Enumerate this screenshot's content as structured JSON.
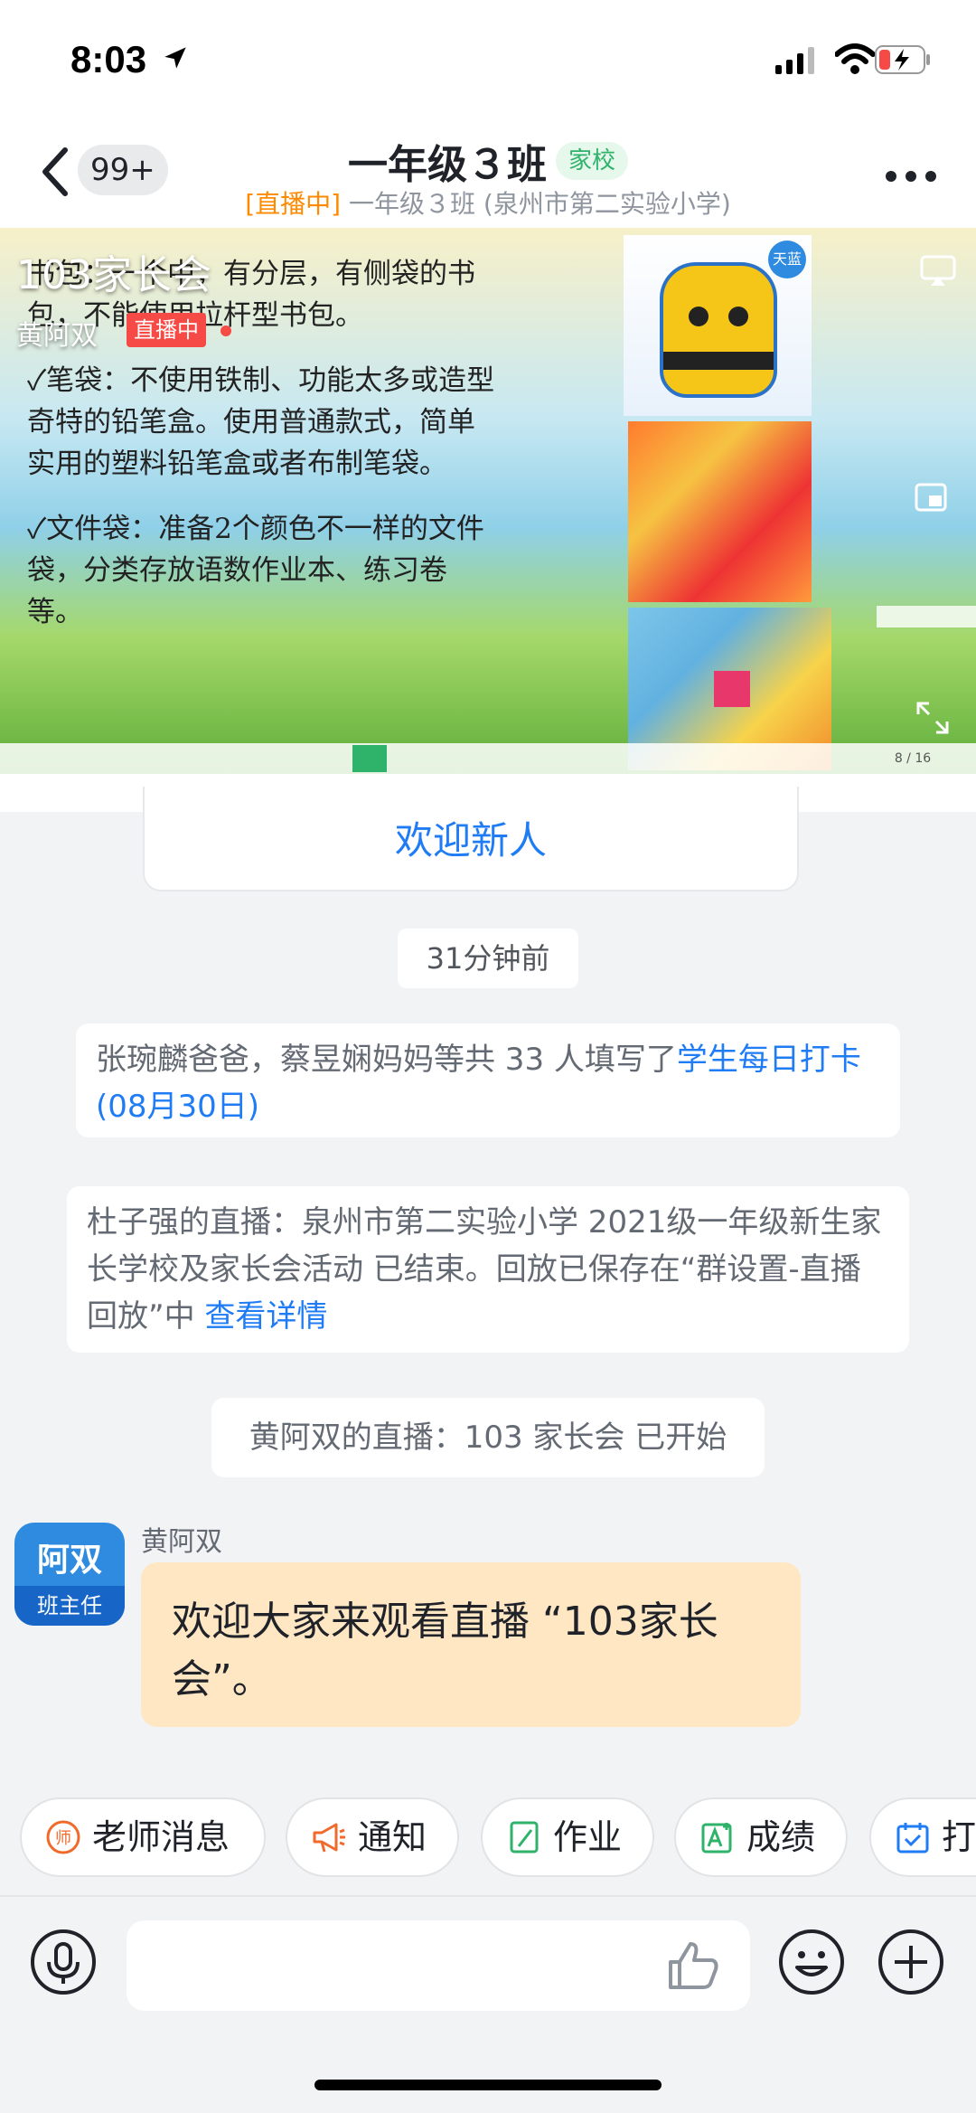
{
  "status": {
    "time": "8:03",
    "icons": [
      "location-arrow-icon",
      "signal-icon",
      "wifi-icon",
      "battery-charging-icon"
    ]
  },
  "header": {
    "back_badge": "99+",
    "title": "一年级３班",
    "tag": "家校",
    "subtitle_live": "[直播中]",
    "subtitle": " 一年级３班 (泉州市第二实验小学)"
  },
  "video": {
    "overlay_title": "103家长会",
    "host": "黄阿双",
    "live_label": "直播中",
    "slide_lines": [
      "书包：一个中，有分层，有侧袋的书包，不能使用拉杆型书包。",
      "✓笔袋：不使用铁制、功能太多或造型奇特的铅笔盒。使用普通款式，简单实用的塑料铅笔盒或者布制笔袋。",
      "✓文件袋：准备2个颜色不一样的文件袋，分类存放语数作业本、练习卷等。"
    ],
    "img_badge": "天蓝",
    "page_indicator": "8 / 16"
  },
  "chat": {
    "welcome": "欢迎新人",
    "time_chip": "31分钟前",
    "sys1_text": "张琬麟爸爸，蔡昱娴妈妈等共 33 人填写了",
    "sys1_link": "学生每日打卡 (08月30日)",
    "sys2_text": "杜子强的直播：泉州市第二实验小学 2021级一年级新生家长学校及家长会活动 已结束。回放已保存在“群设置-直播回放”中 ",
    "sys2_link": "查看详情",
    "sys3_text": "黄阿双的直播：103 家长会 已开始",
    "avatar_name": "阿双",
    "avatar_role": "班主任",
    "sender": "黄阿双",
    "message": "欢迎大家来观看直播 “103家长会”。"
  },
  "quick_actions": [
    {
      "label": "老师消息",
      "icon": "teacher-icon",
      "color": "#f06a2b"
    },
    {
      "label": "通知",
      "icon": "megaphone-icon",
      "color": "#f06a2b"
    },
    {
      "label": "作业",
      "icon": "notebook-icon",
      "color": "#2fb36a"
    },
    {
      "label": "成绩",
      "icon": "grade-icon",
      "color": "#2fb36a"
    },
    {
      "label": "打",
      "icon": "checkin-icon",
      "color": "#1f7cf5"
    }
  ],
  "input": {
    "placeholder": ""
  },
  "colors": {
    "accent": "#1f7cf5",
    "live": "#ff8a00",
    "bubble": "#ffe7c4",
    "tag": "#2fb36a"
  }
}
